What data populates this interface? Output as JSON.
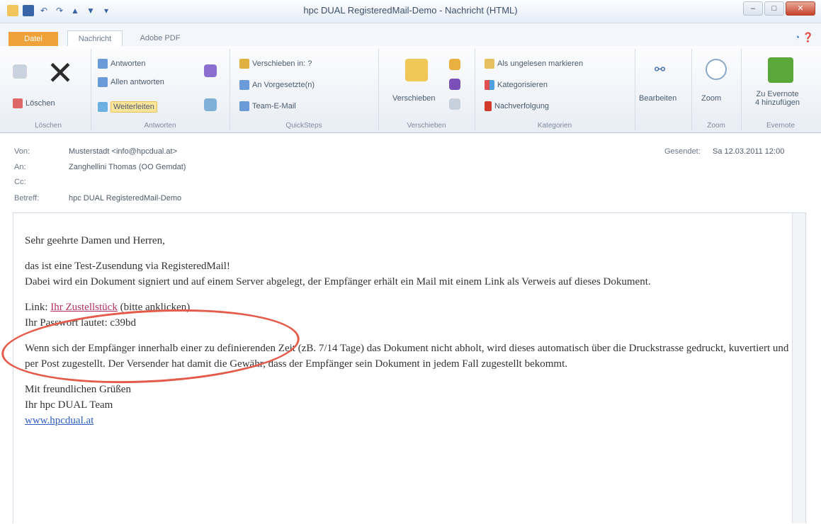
{
  "window": {
    "title": "hpc DUAL RegisteredMail-Demo - Nachricht (HTML)"
  },
  "tabs": {
    "file": "Datei",
    "message": "Nachricht",
    "pdf": "Adobe PDF"
  },
  "ribbon": {
    "delete": {
      "button": "Löschen",
      "group": "Löschen"
    },
    "respond": {
      "reply": "Antworten",
      "reply_all": "Allen antworten",
      "forward": "Weiterleiten",
      "group": "Antworten"
    },
    "quicksteps": {
      "move_to": "Verschieben in: ?",
      "to_manager": "An Vorgesetzte(n)",
      "team_mail": "Team-E-Mail",
      "group": "QuickSteps"
    },
    "move": {
      "move": "Verschieben",
      "group": "Verschieben"
    },
    "tags": {
      "mark_unread": "Als ungelesen markieren",
      "categorize": "Kategorisieren",
      "followup": "Nachverfolgung",
      "group": "Kategorien"
    },
    "editing": {
      "label": "Bearbeiten"
    },
    "zoom": {
      "label": "Zoom",
      "group": "Zoom"
    },
    "evernote": {
      "label_line1": "Zu Evernote",
      "label_line2": "4 hinzufügen",
      "group": "Evernote"
    }
  },
  "header": {
    "from_label": "Von:",
    "from_value": "Musterstadt <info@hpcdual.at>",
    "to_label": "An:",
    "to_value": "Zanghellini Thomas (OO Gemdat)",
    "cc_label": "Cc:",
    "subject_label": "Betreff:",
    "subject_value": "hpc DUAL RegisteredMail-Demo",
    "sent_label": "Gesendet:",
    "sent_value": "Sa 12.03.2011 12:00"
  },
  "message": {
    "greeting": "Sehr geehrte Damen und Herren,",
    "p1_line1": "das ist eine Test-Zusendung via RegisteredMail!",
    "p1_line2": "Dabei wird ein Dokument signiert und auf einem Server abgelegt, der Empfänger erhält ein Mail mit einem Link als Verweis auf dieses Dokument.",
    "link_label": "Link:",
    "link_text": "Ihr Zustellstück",
    "link_hint": "(bitte anklicken)",
    "password_line": "Ihr Passwort lautet: c39bd",
    "p3": "Wenn sich der Empfänger innerhalb einer zu definierenden Zeit (zB. 7/14 Tage) das Dokument nicht abholt, wird dieses automatisch über die Druckstrasse gedruckt, kuvertiert und per Post zugestellt. Der Versender hat damit die Gewähr, dass der Empfänger sein Dokument in jedem Fall zugestellt bekommt.",
    "closing": "Mit freundlichen Grüßen",
    "team": "Ihr hpc DUAL Team",
    "website": "www.hpcdual.at"
  }
}
